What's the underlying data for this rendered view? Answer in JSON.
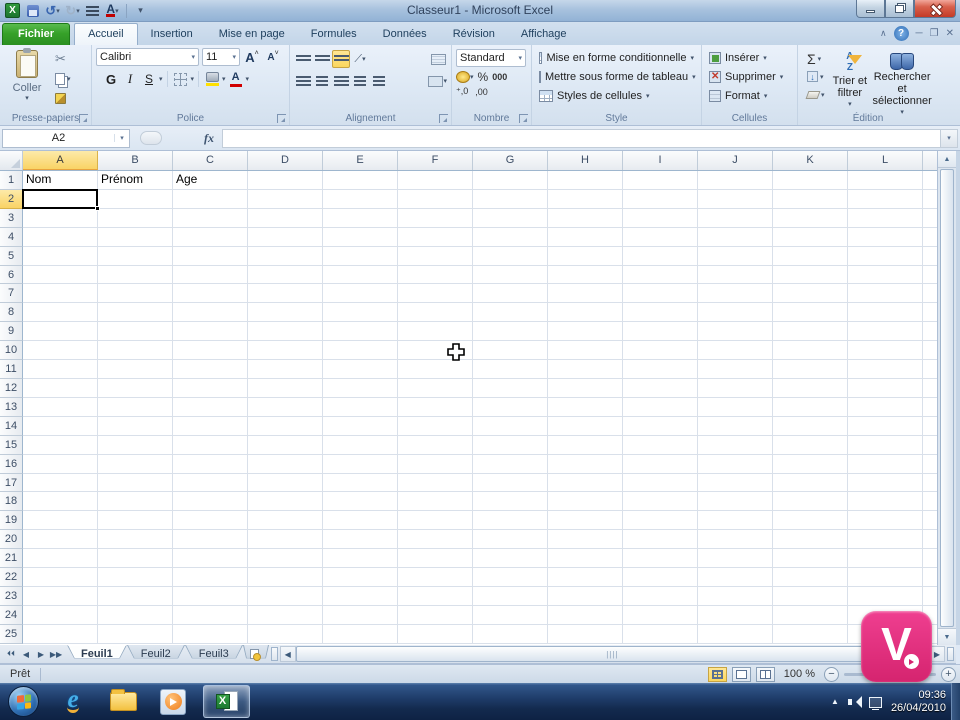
{
  "window": {
    "title": "Classeur1 - Microsoft Excel"
  },
  "ribbon": {
    "tabs": [
      "Fichier",
      "Accueil",
      "Insertion",
      "Mise en page",
      "Formules",
      "Données",
      "Révision",
      "Affichage"
    ],
    "active_tab": "Accueil",
    "clipboard": {
      "label": "Presse-papiers",
      "paste": "Coller"
    },
    "font": {
      "label": "Police",
      "family": "Calibri",
      "size": "11",
      "bold": "G",
      "italic": "I",
      "underline": "S",
      "grow": "A",
      "shrink": "A"
    },
    "align": {
      "label": "Alignement"
    },
    "number": {
      "label": "Nombre",
      "format": "Standard",
      "percent": "%",
      "thousands": "000",
      "inc_decimal": "⁺,0",
      "dec_decimal": ",00"
    },
    "style": {
      "label": "Style",
      "items": [
        "Mise en forme conditionnelle",
        "Mettre sous forme de tableau",
        "Styles de cellules"
      ]
    },
    "cells": {
      "label": "Cellules",
      "items": [
        "Insérer",
        "Supprimer",
        "Format"
      ]
    },
    "editing": {
      "label": "Édition",
      "sum": "Σ",
      "sort": "Trier et filtrer",
      "find": "Rechercher et sélectionner"
    }
  },
  "formula_bar": {
    "name_box": "A2",
    "fx": "fx",
    "formula": ""
  },
  "grid": {
    "columns": [
      "A",
      "B",
      "C",
      "D",
      "E",
      "F",
      "G",
      "H",
      "I",
      "J",
      "K",
      "L"
    ],
    "row_count": 25,
    "cells": {
      "A1": "Nom",
      "B1": "Prénom",
      "C1": "Age"
    },
    "selected_cell": "A2",
    "selected_column": "A",
    "selected_row": 2
  },
  "sheets": {
    "tabs": [
      "Feuil1",
      "Feuil2",
      "Feuil3"
    ],
    "active": "Feuil1"
  },
  "status_bar": {
    "ready": "Prêt",
    "zoom": "100 %"
  },
  "taskbar": {
    "time": "09:36",
    "date": "26/04/2010"
  },
  "watermark": {
    "letter": "V"
  },
  "colors": {
    "fichier_green": "#36a129",
    "selection_yellow": "#f9d365",
    "watermark_pink": "#e0267c",
    "close_red": "#c43a27"
  }
}
